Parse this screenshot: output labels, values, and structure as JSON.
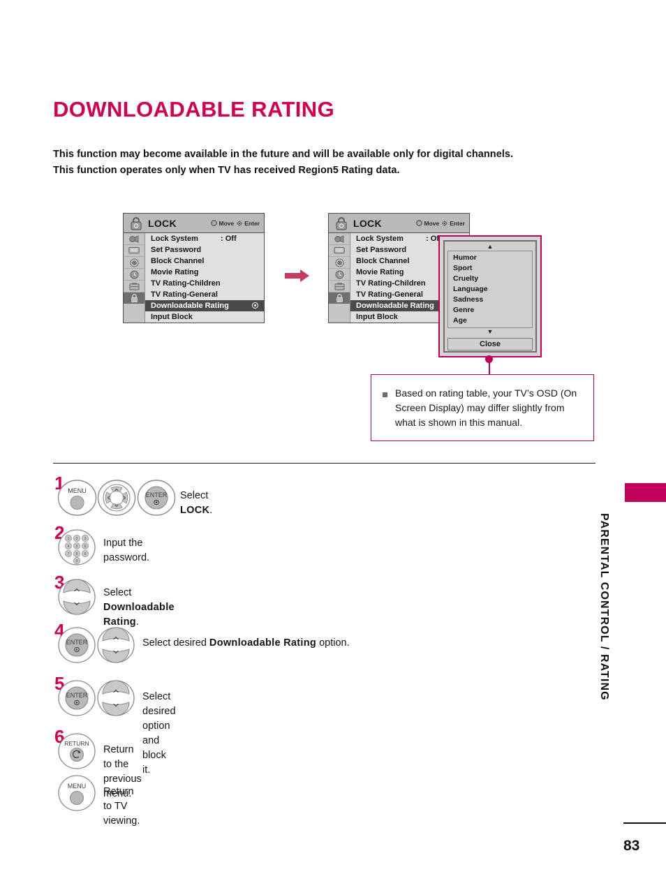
{
  "document": {
    "title": "DOWNLOADABLE RATING",
    "intro_line_1": "This function may become available in the future and will be available only for digital channels.",
    "intro_line_2": "This function operates only when TV has received Region5 Rating data.",
    "page_number": "83",
    "sidebar_label": "PARENTAL CONTROL / RATING",
    "accent_color": "#d2004f",
    "callout_border_color": "#c2005a"
  },
  "osd_menu": {
    "title": "LOCK",
    "hints": [
      {
        "icon": "dpad-icon",
        "label": "Move"
      },
      {
        "icon": "enter-dot-icon",
        "label": "Enter"
      }
    ],
    "icons": [
      "picture-icon",
      "screen-icon",
      "audio-icon",
      "time-icon",
      "option-icon",
      "lock-icon"
    ],
    "items": [
      {
        "label": "Lock System",
        "value": ": Off",
        "selected": false
      },
      {
        "label": "Set Password",
        "value": "",
        "selected": false
      },
      {
        "label": "Block Channel",
        "value": "",
        "selected": false
      },
      {
        "label": "Movie Rating",
        "value": "",
        "selected": false
      },
      {
        "label": "TV Rating-Children",
        "value": "",
        "selected": false
      },
      {
        "label": "TV Rating-General",
        "value": "",
        "selected": false
      },
      {
        "label": "Downloadable Rating",
        "value": "",
        "selected": true
      },
      {
        "label": "Input Block",
        "value": "",
        "selected": false
      }
    ]
  },
  "rating_popup": {
    "scroll_up": "▲",
    "scroll_down": "▼",
    "options": [
      "Humor",
      "Sport",
      "Cruelty",
      "Language",
      "Sadness",
      "Genre",
      "Age"
    ],
    "close_label": "Close"
  },
  "callout": {
    "text": "Based on rating table, your TV’s OSD (On Screen Display) may differ slightly from what is shown in this manual."
  },
  "steps": [
    {
      "number": "1",
      "buttons": [
        "menu-button",
        "dpad-button",
        "enter-button"
      ],
      "text_plain": "Select ",
      "text_bold": "LOCK",
      "text_tail": "."
    },
    {
      "number": "2",
      "buttons": [
        "number-keypad-button"
      ],
      "text_plain": "Input the password.",
      "text_bold": "",
      "text_tail": ""
    },
    {
      "number": "3",
      "buttons": [
        "updown-button"
      ],
      "text_plain": "Select ",
      "text_bold": "Downloadable Rating",
      "text_tail": "."
    },
    {
      "number": "4",
      "buttons": [
        "enter-button",
        "updown-button"
      ],
      "text_plain": "Select desired ",
      "text_bold": "Downloadable Rating",
      "text_tail": " option."
    },
    {
      "number": "5",
      "buttons": [
        "enter-button",
        "updown-button"
      ],
      "text_plain": "Select desired option and block it.",
      "text_bold": "",
      "text_tail": ""
    },
    {
      "number": "6",
      "buttons": [
        "return-button"
      ],
      "text_plain": "Return to the previous menu.",
      "text_bold": "",
      "text_tail": ""
    },
    {
      "number": "",
      "buttons": [
        "menu-button"
      ],
      "text_plain": "Return to TV viewing.",
      "text_bold": "",
      "text_tail": ""
    }
  ],
  "button_labels": {
    "menu": "MENU",
    "enter": "ENTER",
    "return": "RETURN",
    "keypad_digits": [
      "1",
      "2",
      "3",
      "4",
      "5",
      "6",
      "7",
      "8",
      "9",
      "0"
    ]
  }
}
